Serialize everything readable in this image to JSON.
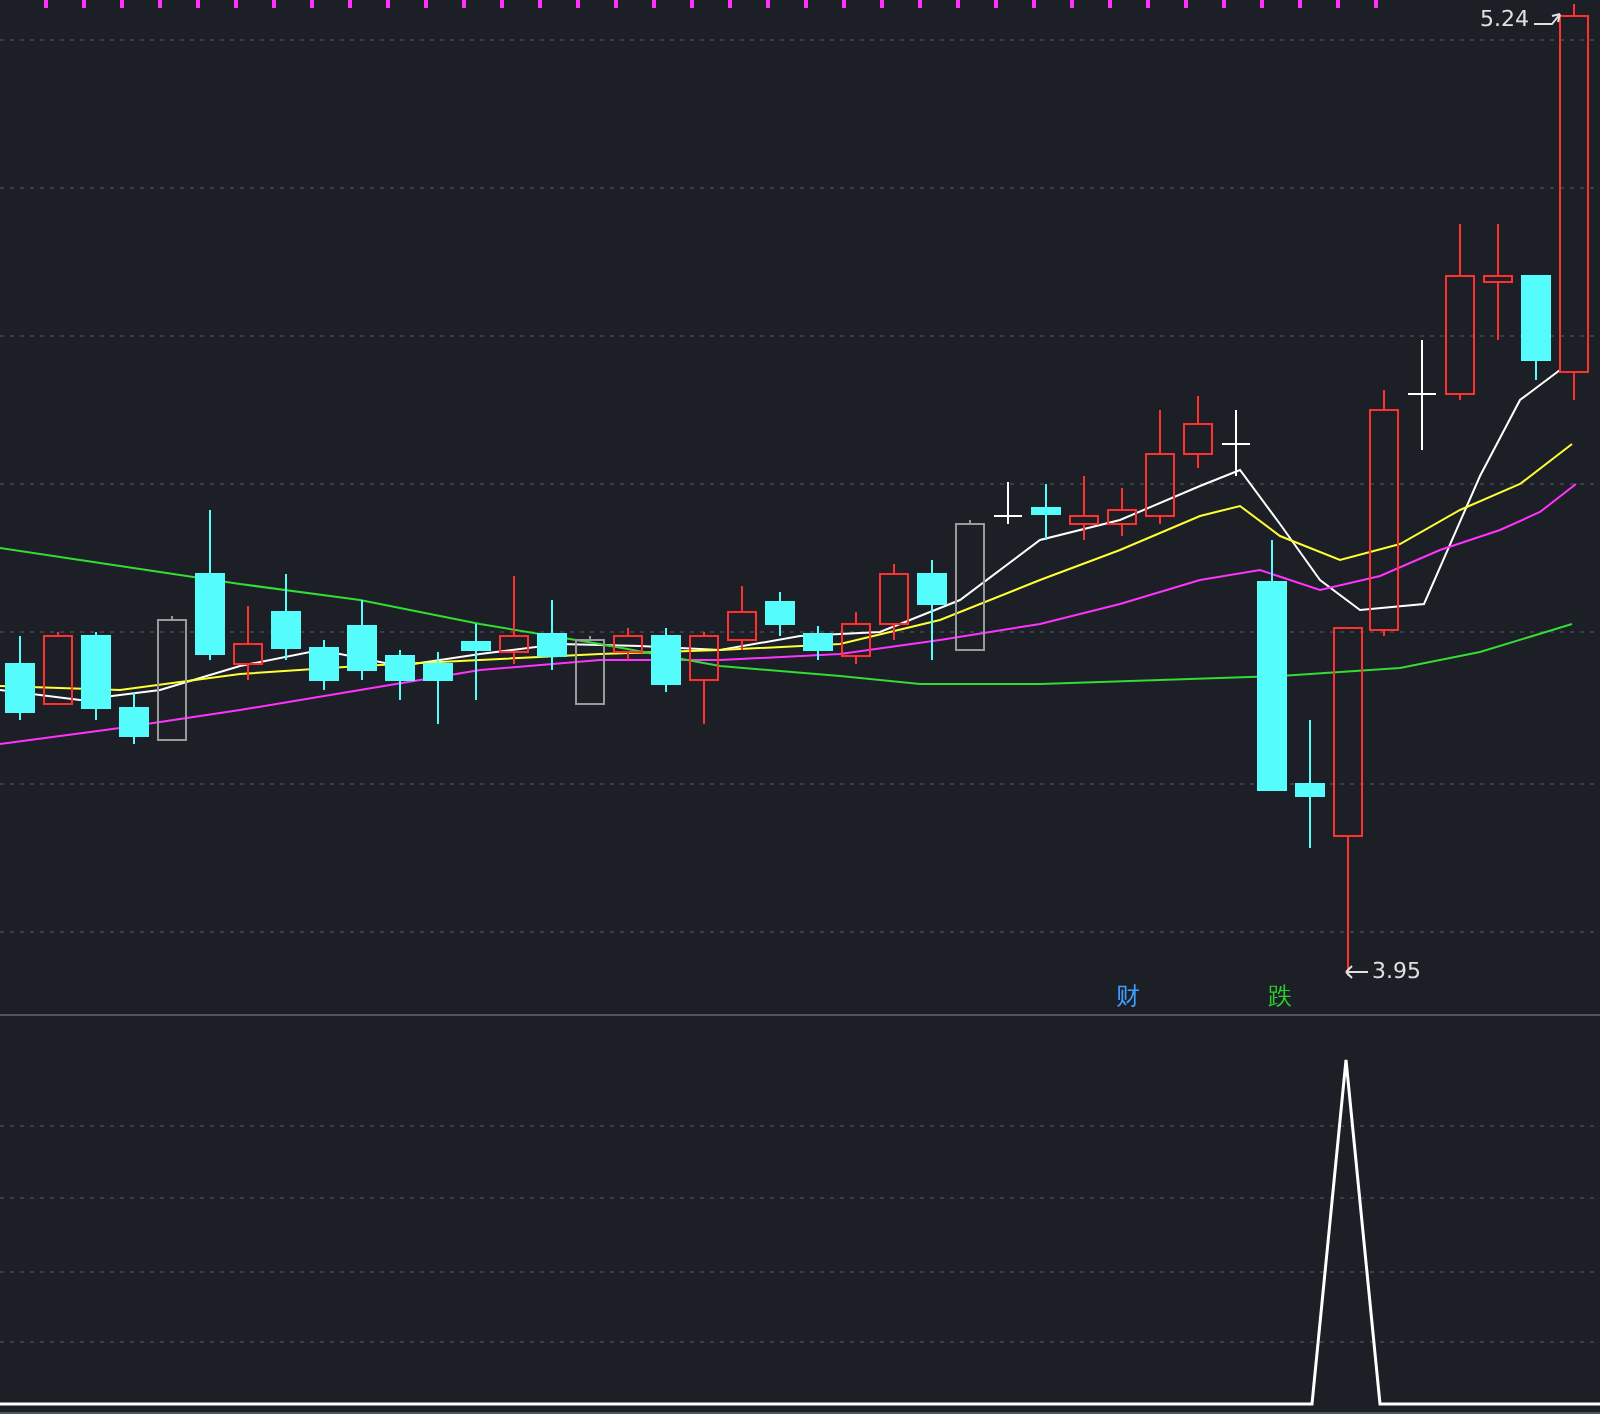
{
  "price_panel": {
    "high_label": "5.24",
    "low_label": "3.95",
    "signals": [
      {
        "label": "财",
        "color": "#3f9fff"
      },
      {
        "label": "跌",
        "color": "#2ecc2e"
      }
    ]
  }
}
